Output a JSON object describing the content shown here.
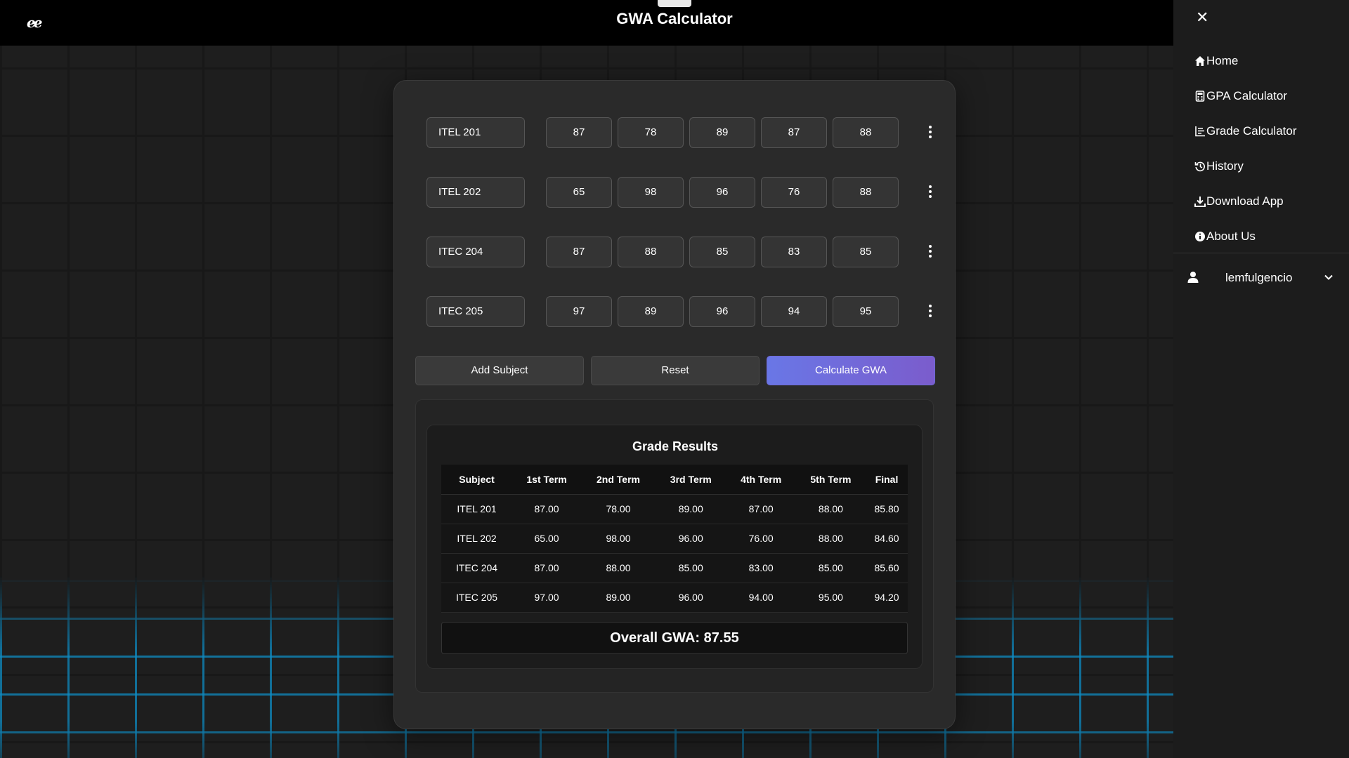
{
  "app": {
    "logo_text": "ee",
    "title": "GWA Calculator"
  },
  "sidemenu": {
    "close_label": "✕",
    "items": [
      {
        "label": "Home",
        "icon": "home-icon"
      },
      {
        "label": "GPA Calculator",
        "icon": "calculator-icon"
      },
      {
        "label": "Grade Calculator",
        "icon": "chart-icon"
      },
      {
        "label": "History",
        "icon": "history-icon"
      },
      {
        "label": "Download App",
        "icon": "download-icon"
      },
      {
        "label": "About Us",
        "icon": "info-icon"
      }
    ],
    "user": {
      "name": "lemfulgencio",
      "icon": "user-icon",
      "chevron": "chevron-down-icon"
    }
  },
  "subjects": [
    {
      "name": "ITEL 201",
      "grades": [
        "87",
        "78",
        "89",
        "87",
        "88"
      ]
    },
    {
      "name": "ITEL 202",
      "grades": [
        "65",
        "98",
        "96",
        "76",
        "88"
      ]
    },
    {
      "name": "ITEC 204",
      "grades": [
        "87",
        "88",
        "85",
        "83",
        "85"
      ]
    },
    {
      "name": "ITEC 205",
      "grades": [
        "97",
        "89",
        "96",
        "94",
        "95"
      ]
    }
  ],
  "buttons": {
    "add_subject": "Add Subject",
    "reset": "Reset",
    "calculate": "Calculate GWA"
  },
  "results": {
    "title": "Grade Results",
    "headers": [
      "Subject",
      "1st Term",
      "2nd Term",
      "3rd Term",
      "4th Term",
      "5th Term",
      "Final"
    ],
    "rows": [
      [
        "ITEL 201",
        "87.00",
        "78.00",
        "89.00",
        "87.00",
        "88.00",
        "85.80"
      ],
      [
        "ITEL 202",
        "65.00",
        "98.00",
        "96.00",
        "76.00",
        "88.00",
        "84.60"
      ],
      [
        "ITEC 204",
        "87.00",
        "88.00",
        "85.00",
        "83.00",
        "85.00",
        "85.60"
      ],
      [
        "ITEC 205",
        "97.00",
        "89.00",
        "96.00",
        "94.00",
        "95.00",
        "94.20"
      ]
    ],
    "overall": "Overall GWA: 87.55"
  },
  "colors": {
    "accent_start": "#6977e6",
    "accent_end": "#7b5ccc",
    "grid_glow": "#0f8cc3"
  }
}
